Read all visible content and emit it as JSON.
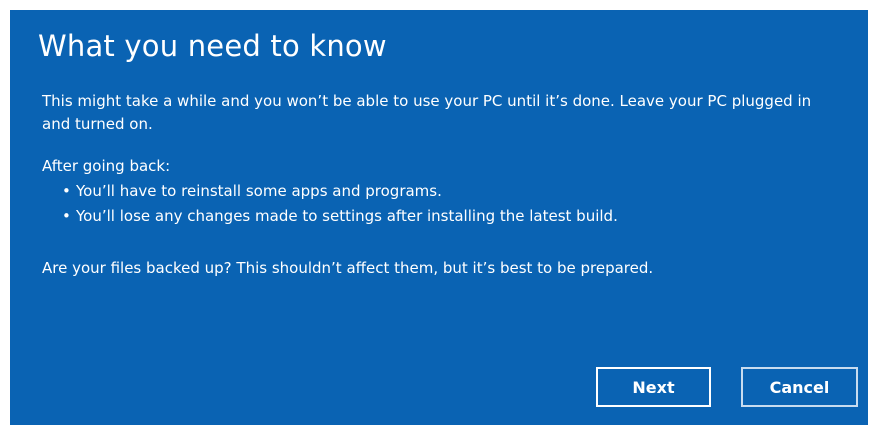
{
  "dialog": {
    "title": "What you need to know",
    "paragraph1": "This might take a while and you won’t be able to use your PC until it’s done. Leave your PC plugged in and turned on.",
    "paragraph2": "After going back:",
    "bullets": [
      "You’ll have to reinstall some apps and programs.",
      "You’ll lose any changes made to settings after installing the latest build."
    ],
    "paragraph3": "Are your files backed up? This shouldn’t affect them, but it’s best to be prepared.",
    "next_label": "Next",
    "cancel_label": "Cancel"
  },
  "colors": {
    "background": "#0a63b3",
    "text": "#ffffff"
  }
}
